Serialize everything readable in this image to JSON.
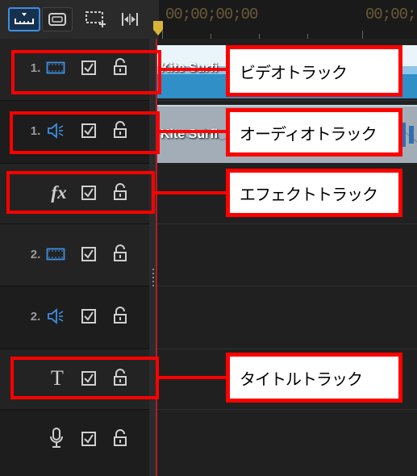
{
  "toolbar": {
    "buttons": [
      {
        "name": "track-view",
        "icon": "timeline-track-view-icon",
        "active": true
      },
      {
        "name": "storyboard",
        "icon": "storyboard-view-icon",
        "active": false
      },
      {
        "name": "add-track",
        "icon": "track-manager-icon",
        "active": false
      },
      {
        "name": "fit",
        "icon": "fit-timeline-icon",
        "active": false
      }
    ]
  },
  "ruler": {
    "timecode_start": "00;00;00;00",
    "timecode_next": "00;00;"
  },
  "tracks": [
    {
      "id": "video-1",
      "number": "1.",
      "icon": "video-track-icon",
      "enabled": true,
      "locked": false
    },
    {
      "id": "audio-1",
      "number": "1.",
      "icon": "audio-track-icon",
      "enabled": true,
      "locked": false
    },
    {
      "id": "effect",
      "number": "",
      "icon": "fx-icon",
      "icon_text": "fx",
      "enabled": true,
      "locked": false
    },
    {
      "id": "video-2",
      "number": "2.",
      "icon": "video-track-icon",
      "enabled": true,
      "locked": false
    },
    {
      "id": "audio-2",
      "number": "2.",
      "icon": "audio-track-icon",
      "enabled": true,
      "locked": false
    },
    {
      "id": "title",
      "number": "",
      "icon": "title-track-icon",
      "icon_text": "T",
      "enabled": true,
      "locked": false
    },
    {
      "id": "voice",
      "number": "",
      "icon": "microphone-icon",
      "enabled": true,
      "locked": false
    }
  ],
  "clips": {
    "video": {
      "label": "Kite Surfi"
    },
    "audio": {
      "label": "Kite Surfi"
    }
  },
  "callouts": {
    "video": "ビデオトラック",
    "audio": "オーディオトラック",
    "effect": "エフェクトトラック",
    "title": "タイトルトラック"
  },
  "colors": {
    "highlight": "#ff0000",
    "accent": "#3d8fe0",
    "playhead": "#b01e2c"
  }
}
